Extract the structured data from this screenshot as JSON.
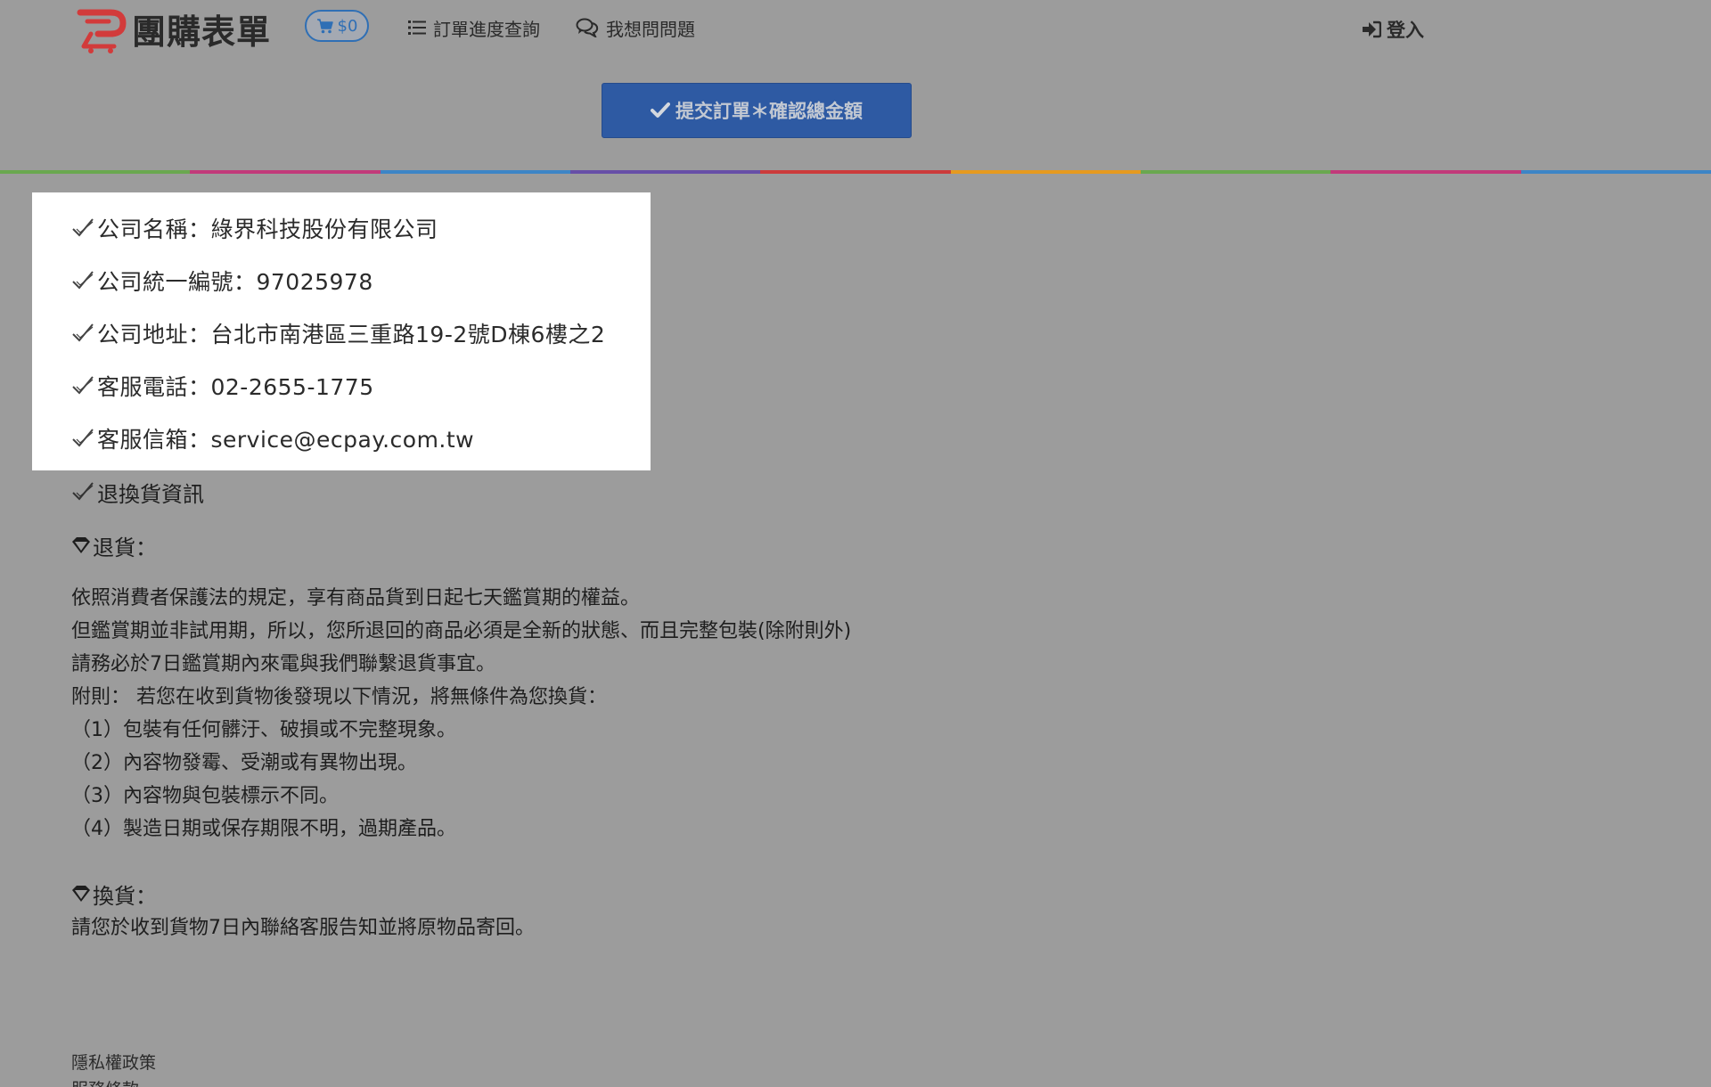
{
  "header": {
    "logo_text": "團購表單",
    "cart_amount": "$0",
    "nav": {
      "orders_label": "訂單進度查詢",
      "ask_label": "我想問問題"
    },
    "login_label": "登入",
    "submit_label": "提交訂單＊確認總金額"
  },
  "colors": {
    "primary": "#2e5aa3",
    "logo_red": "#d23b3b",
    "rainbow": [
      "#6aa84f",
      "#c23a7a",
      "#3d85c6",
      "#674ea7",
      "#cc3b3b",
      "#e69a1f",
      "#6aa84f",
      "#c23a7a",
      "#3d85c6"
    ]
  },
  "company_info": [
    "公司名稱：綠界科技股份有限公司",
    "公司統一編號：97025978",
    "公司地址：台北市南港區三重路19-2號D棟6樓之2",
    "客服電話：02-2655-1775",
    "客服信箱：service@ecpay.com.tw"
  ],
  "return_info_title": "退換貨資訊",
  "returns": {
    "heading": "退貨：",
    "lines": [
      "依照消費者保護法的規定，享有商品貨到日起七天鑑賞期的權益。",
      "但鑑賞期並非試用期，所以，您所退回的商品必須是全新的狀態、而且完整包裝(除附則外)",
      "請務必於7日鑑賞期內來電與我們聯繫退貨事宜。",
      "附則： 若您在收到貨物後發現以下情況，將無條件為您換貨：",
      "（1）包裝有任何髒汙、破損或不完整現象。",
      "（2）內容物發霉、受潮或有異物出現。",
      "（3）內容物與包裝標示不同。",
      "（4）製造日期或保存期限不明，過期產品。"
    ]
  },
  "exchange": {
    "heading": "換貨：",
    "lines": [
      "請您於收到貨物7日內聯絡客服告知並將原物品寄回。"
    ]
  },
  "footer": {
    "privacy_label": "隱私權政策",
    "terms_label": "服務條款"
  }
}
